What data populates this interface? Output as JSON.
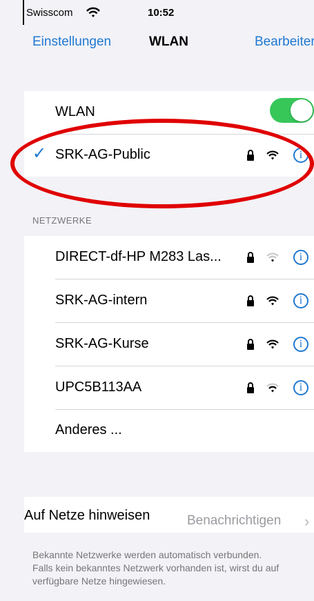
{
  "status": {
    "carrier": "Swisscom",
    "time": "10:52"
  },
  "nav": {
    "back": "Einstellungen",
    "title": "WLAN",
    "edit": "Bearbeiten"
  },
  "wlan": {
    "label": "WLAN",
    "enabled": true
  },
  "current_network": {
    "name": "SRK-AG-Public"
  },
  "section": {
    "title": "NETZWERKE"
  },
  "networks": [
    {
      "name": "DIRECT-df-HP M283 Las..."
    },
    {
      "name": "SRK-AG-intern"
    },
    {
      "name": "SRK-AG-Kurse"
    },
    {
      "name": "UPC5B113AA"
    },
    {
      "name": "Anderes ..."
    }
  ],
  "hint": {
    "label": "Auf Netze hinweisen",
    "value": "Benachrichtigen",
    "footer": "Bekannte Netzwerke werden automatisch verbunden. Falls kein bekanntes Netzwerk vorhanden ist, wirst du auf verfügbare Netze hingewiesen."
  },
  "colors": {
    "accent": "#1f78d1",
    "toggle": "#37c759",
    "annotation": "#e00000"
  }
}
